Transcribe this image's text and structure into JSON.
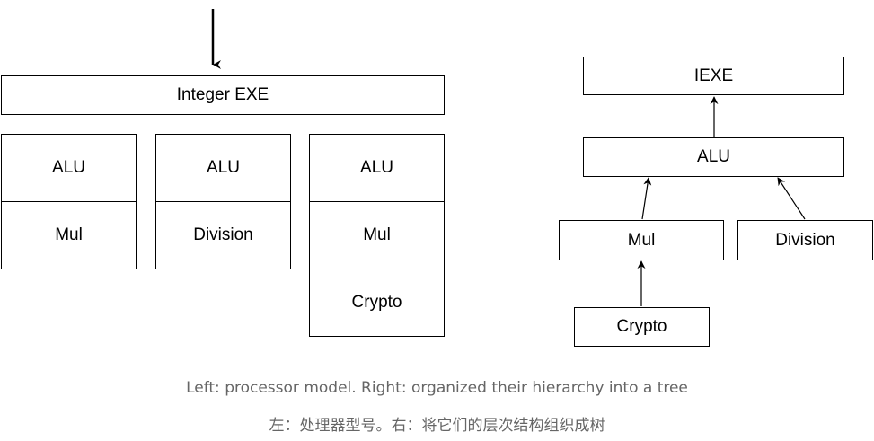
{
  "left": {
    "integer_exe": "Integer EXE",
    "unit1": {
      "alu": "ALU",
      "mul": "Mul"
    },
    "unit2": {
      "alu": "ALU",
      "division": "Division"
    },
    "unit3": {
      "alu": "ALU",
      "mul": "Mul",
      "crypto": "Crypto"
    }
  },
  "tree": {
    "iexe": "IEXE",
    "alu": "ALU",
    "mul": "Mul",
    "division": "Division",
    "crypto": "Crypto"
  },
  "captions": {
    "english": "Left: processor model. Right: organized their hierarchy into a tree",
    "chinese": "左：处理器型号。右：将它们的层次结构组织成树"
  }
}
